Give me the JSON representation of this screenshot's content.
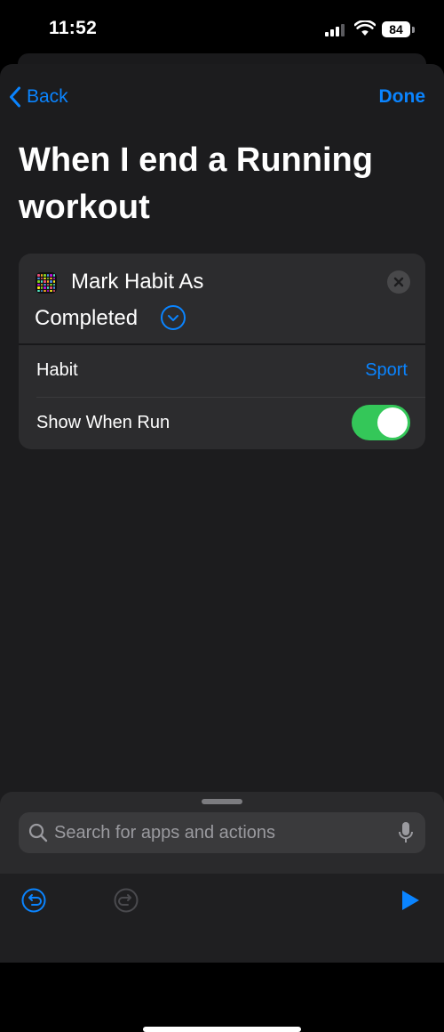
{
  "status": {
    "time": "11:52",
    "battery": "84"
  },
  "nav": {
    "back_label": "Back",
    "done_label": "Done"
  },
  "title": "When I end a Running workout",
  "action": {
    "title_line1": "Mark Habit As",
    "title_line2": "Completed",
    "params": [
      {
        "label": "Habit",
        "value": "Sport"
      },
      {
        "label": "Show When Run",
        "toggle_on": true
      }
    ]
  },
  "search": {
    "placeholder": "Search for apps and actions"
  },
  "colors": {
    "accent": "#0a84ff",
    "toggle_on": "#34c759",
    "sheet_bg": "#1c1c1e",
    "card_bg": "#2c2c2e"
  }
}
